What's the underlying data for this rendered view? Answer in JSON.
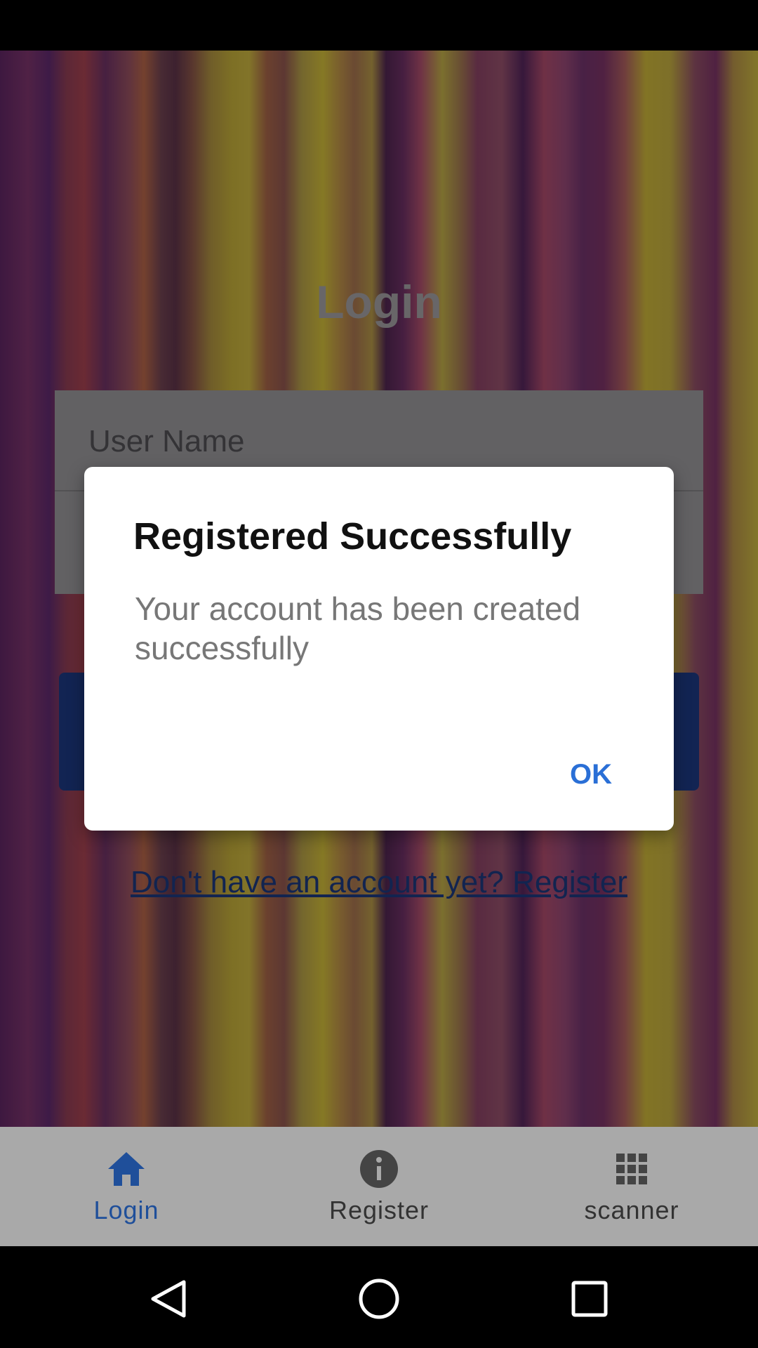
{
  "screen": {
    "title": "Login",
    "username_placeholder": "User Name",
    "register_link": "Don't have an account yet? Register"
  },
  "dialog": {
    "title": "Registered Successfully",
    "message": "Your account has been created successfully",
    "ok_label": "OK"
  },
  "bottom_nav": {
    "items": [
      {
        "label": "Login",
        "icon": "home-icon",
        "active": true
      },
      {
        "label": "Register",
        "icon": "info-icon",
        "active": false
      },
      {
        "label": "scanner",
        "icon": "grid-icon",
        "active": false
      }
    ]
  },
  "colors": {
    "accent": "#2a6fd6",
    "nav_active": "#1f4f9a",
    "login_button": "#1f3f8f"
  }
}
